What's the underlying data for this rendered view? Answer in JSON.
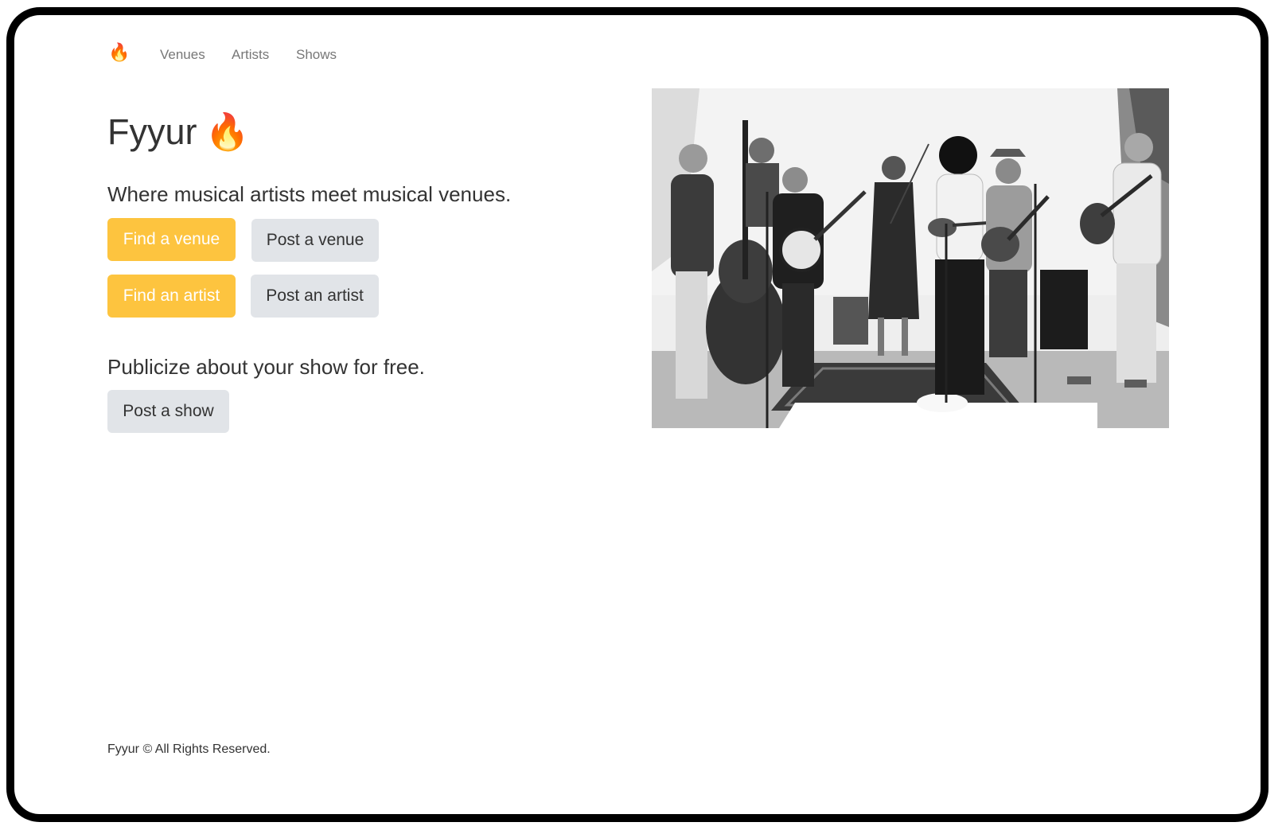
{
  "nav": {
    "brand_icon": "fire-icon",
    "brand_glyph": "🔥",
    "links": [
      {
        "label": "Venues"
      },
      {
        "label": "Artists"
      },
      {
        "label": "Shows"
      }
    ]
  },
  "hero": {
    "title": "Fyyur",
    "title_icon": "fire-icon",
    "title_glyph": "🔥",
    "tagline": "Where musical artists meet musical venues.",
    "buttons": {
      "find_venue": "Find a venue",
      "post_venue": "Post a venue",
      "find_artist": "Find an artist",
      "post_artist": "Post an artist"
    },
    "show_prompt": "Publicize about your show for free.",
    "post_show": "Post a show",
    "photo": {
      "kind": "black-and-white photo of a bluegrass band performing",
      "icon": "band-photo"
    }
  },
  "footer": {
    "text": "Fyyur © All Rights Reserved."
  },
  "colors": {
    "accent": "#fdc43f",
    "secondary": "#e1e4e8",
    "text": "#333333",
    "nav_text": "#777777",
    "frame": "#000000"
  }
}
